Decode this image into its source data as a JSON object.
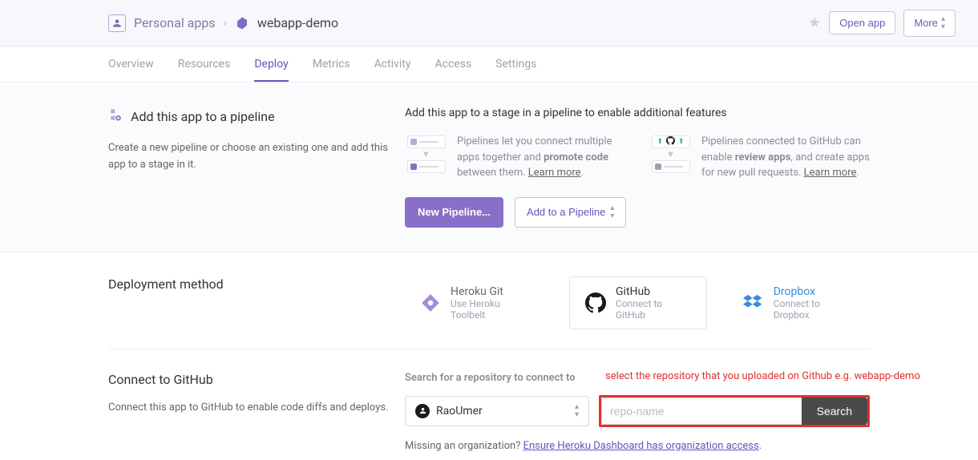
{
  "breadcrumb": {
    "personal_apps": "Personal apps",
    "app_name": "webapp-demo"
  },
  "topbar": {
    "open_app": "Open app",
    "more": "More"
  },
  "tabs": {
    "overview": "Overview",
    "resources": "Resources",
    "deploy": "Deploy",
    "metrics": "Metrics",
    "activity": "Activity",
    "access": "Access",
    "settings": "Settings"
  },
  "pipeline": {
    "title": "Add this app to a pipeline",
    "desc": "Create a new pipeline or choose an existing one and add this app to a stage in it.",
    "headline": "Add this app to a stage in a pipeline to enable additional features",
    "col1_pre": "Pipelines let you connect multiple apps together and ",
    "col1_bold": "promote code",
    "col1_post": " between them. ",
    "col1_link": "Learn more",
    "col2_pre": "Pipelines connected to GitHub can enable ",
    "col2_bold": "review apps",
    "col2_post": ", and create apps for new pull requests. ",
    "col2_link": "Learn more",
    "new_pipeline": "New Pipeline...",
    "add_to_pipeline": "Add to a Pipeline"
  },
  "deploy_method": {
    "heading": "Deployment method",
    "heroku_git_title": "Heroku Git",
    "heroku_git_sub": "Use Heroku Toolbelt",
    "github_title": "GitHub",
    "github_sub": "Connect to GitHub",
    "dropbox_title": "Dropbox",
    "dropbox_sub": "Connect to Dropbox"
  },
  "connect": {
    "heading": "Connect to GitHub",
    "desc": "Connect this app to GitHub to enable code diffs and deploys.",
    "search_label": "Search for a repository to connect to",
    "owner": "RaoUmer",
    "placeholder": "repo-name",
    "search_btn": "Search",
    "annotation": "select the repository that you uploaded on Github e.g. webapp-demo",
    "missing_pre": "Missing an organization? ",
    "missing_link": "Ensure Heroku Dashboard has organization access"
  }
}
